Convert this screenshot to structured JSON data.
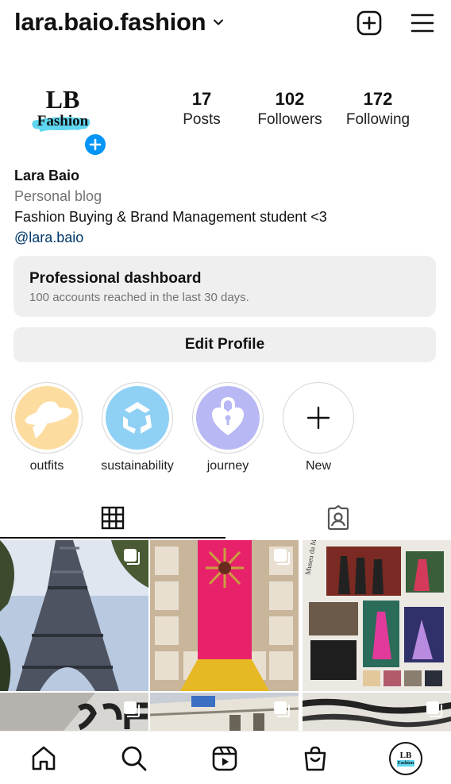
{
  "header": {
    "username": "lara.baio.fashion",
    "icons": [
      "chevron-down-icon",
      "new-post-icon",
      "menu-icon"
    ]
  },
  "profile": {
    "avatar_text_top": "LB",
    "avatar_text_bottom": "Fashion",
    "stats": {
      "posts_count": "17",
      "posts_label": "Posts",
      "followers_count": "102",
      "followers_label": "Followers",
      "following_count": "172",
      "following_label": "Following"
    }
  },
  "bio": {
    "name": "Lara Baio",
    "category": "Personal blog",
    "text": "Fashion Buying & Brand Management student <3",
    "link": "@lara.baio"
  },
  "dashboard": {
    "title": "Professional dashboard",
    "subtitle": "100 accounts reached in the last 30 days."
  },
  "edit_profile_label": "Edit Profile",
  "highlights": [
    {
      "label": "outfits",
      "icon": "hat-icon",
      "color": "#fddca0"
    },
    {
      "label": "sustainability",
      "icon": "recycle-icon",
      "color": "#8fd0f5"
    },
    {
      "label": "journey",
      "icon": "heart-lock-icon",
      "color": "#b8b8f4"
    },
    {
      "label": "New",
      "icon": "plus-icon",
      "color": "#ffffff"
    }
  ],
  "tabs": [
    {
      "name": "grid",
      "icon": "grid-icon",
      "active": true
    },
    {
      "name": "tagged",
      "icon": "tagged-user-icon",
      "active": false
    }
  ],
  "posts": [
    {
      "subject": "eiffel-tower-photo",
      "multi": true
    },
    {
      "subject": "pink-gown-exhibit-photo",
      "multi": true
    },
    {
      "subject": "fashion-moodboard-photo",
      "multi": false
    },
    {
      "subject": "store-sign-photo",
      "multi": true
    },
    {
      "subject": "building-facade-photo",
      "multi": true
    },
    {
      "subject": "zebra-pattern-photo",
      "multi": true
    }
  ],
  "moodboard_caption": "Museu da Moda",
  "bottom_nav": {
    "items": [
      "home-icon",
      "search-icon",
      "reels-icon",
      "shop-icon",
      "profile-avatar"
    ],
    "avatar_text_top": "LB",
    "avatar_text_bottom": "Fashion"
  }
}
